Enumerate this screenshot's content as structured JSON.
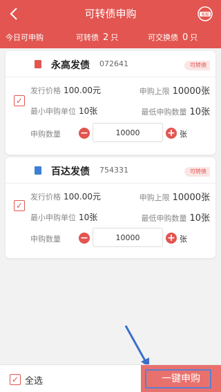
{
  "nav": {
    "back_icon": "chevron-left-icon",
    "title": "可转债申购",
    "service_icon": "customer-service-icon",
    "service_label": "客服"
  },
  "stats": {
    "today_label": "今日可申购",
    "convertible_label": "可转债",
    "convertible_count": "2",
    "convertible_unit": "只",
    "exchangeable_label": "可交换债",
    "exchangeable_count": "0",
    "exchangeable_unit": "只"
  },
  "bonds": [
    {
      "name": "永高发债",
      "code": "072641",
      "tag": "可转债",
      "logo_color": "#e25550",
      "checked": true,
      "price_label": "发行价格",
      "price": "100.00元",
      "limit_label": "申购上限",
      "limit": "10000张",
      "min_unit_label": "最小申购单位",
      "min_unit": "10张",
      "min_qty_label": "最低申购数量",
      "min_qty": "10张",
      "qty_label": "申购数量",
      "qty": "10000",
      "qty_unit": "张"
    },
    {
      "name": "百达发债",
      "code": "754331",
      "tag": "可转债",
      "logo_color": "#3b7fd4",
      "checked": true,
      "price_label": "发行价格",
      "price": "100.00元",
      "limit_label": "申购上限",
      "limit": "10000张",
      "min_unit_label": "最小申购单位",
      "min_unit": "10张",
      "min_qty_label": "最低申购数量",
      "min_qty": "10张",
      "qty_label": "申购数量",
      "qty": "10000",
      "qty_unit": "张"
    }
  ],
  "bottom": {
    "select_all": "全选",
    "select_all_checked": true,
    "submit": "一键申购"
  },
  "colors": {
    "primary": "#e25550",
    "submit_bg": "#e9716d",
    "highlight_border": "#5a7fd0"
  }
}
